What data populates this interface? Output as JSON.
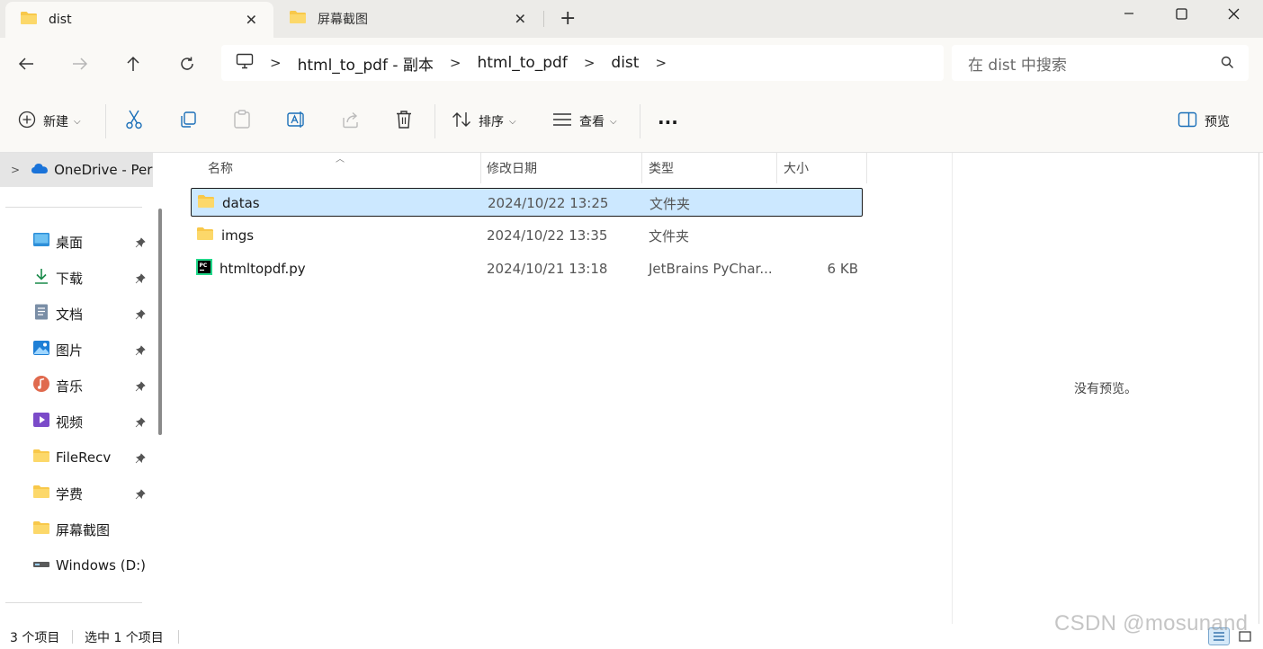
{
  "tabs": [
    {
      "label": "dist",
      "active": true
    },
    {
      "label": "屏幕截图",
      "active": false
    }
  ],
  "window_controls": [
    "minimize",
    "maximize",
    "close"
  ],
  "address": {
    "breadcrumbs": [
      "html_to_pdf - 副本",
      "html_to_pdf",
      "dist"
    ]
  },
  "search": {
    "placeholder": "在 dist 中搜索"
  },
  "toolbar": {
    "new_label": "新建",
    "sort_label": "排序",
    "view_label": "查看",
    "more_label": "...",
    "preview_label": "预览"
  },
  "sidebar": {
    "onedrive_label": "OneDrive - Per",
    "items": [
      {
        "label": "桌面",
        "icon": "desktop-icon",
        "pinned": true
      },
      {
        "label": "下载",
        "icon": "download-icon",
        "pinned": true
      },
      {
        "label": "文档",
        "icon": "document-icon",
        "pinned": true
      },
      {
        "label": "图片",
        "icon": "pictures-icon",
        "pinned": true
      },
      {
        "label": "音乐",
        "icon": "music-icon",
        "pinned": true
      },
      {
        "label": "视频",
        "icon": "video-icon",
        "pinned": true
      },
      {
        "label": "FileRecv",
        "icon": "folder-icon",
        "pinned": true
      },
      {
        "label": "学费",
        "icon": "folder-icon",
        "pinned": true
      },
      {
        "label": "屏幕截图",
        "icon": "folder-icon",
        "pinned": false
      },
      {
        "label": "Windows (D:)",
        "icon": "drive-icon",
        "pinned": false
      }
    ]
  },
  "columns": {
    "name": "名称",
    "date": "修改日期",
    "type": "类型",
    "size": "大小"
  },
  "files": [
    {
      "name": "datas",
      "date": "2024/10/22 13:25",
      "type": "文件夹",
      "size": "",
      "icon": "folder-icon",
      "selected": true
    },
    {
      "name": "imgs",
      "date": "2024/10/22 13:35",
      "type": "文件夹",
      "size": "",
      "icon": "folder-icon",
      "selected": false
    },
    {
      "name": "htmltopdf.py",
      "date": "2024/10/21 13:18",
      "type": "JetBrains PyChar...",
      "size": "6 KB",
      "icon": "pycharm-file-icon",
      "selected": false
    }
  ],
  "preview": {
    "empty_text": "没有预览。"
  },
  "status": {
    "item_count": "3 个项目",
    "selected_count": "选中 1 个项目"
  },
  "watermark": "CSDN @mosunand",
  "colors": {
    "selection_bg": "#cce8ff",
    "folder_yellow": "#f8c84a",
    "onedrive_blue": "#1a73d9",
    "sidebar_hover": "#e5e5e5"
  }
}
